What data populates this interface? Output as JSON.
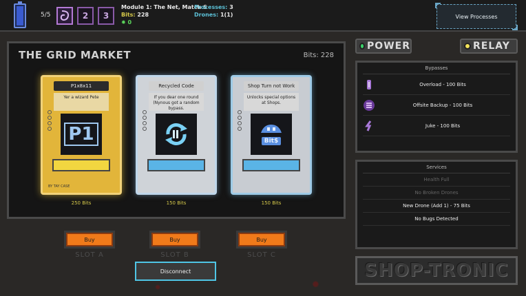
{
  "topbar": {
    "battery_count": "5/5",
    "slots": [
      "",
      "2",
      "3"
    ],
    "module_title": "Module 1: The Net, Match 6",
    "bits_label": "Bits:",
    "bits_value": "228",
    "bugs_value": "0",
    "processes_label": "Processes:",
    "processes_value": "3",
    "drones_label": "Drones:",
    "drones_value": "1(1)",
    "view_processes": "View Processes"
  },
  "market": {
    "title": "THE GRID MARKET",
    "bits": "Bits: 228",
    "cards": [
      {
        "title": "P1x8x11",
        "desc": "Yer a wizard Pete",
        "art_text": "P1",
        "footer": "BY TAY CASE",
        "price": "250 Bits"
      },
      {
        "title": "Recycled Code",
        "desc": "If you dear one round (Nynous got a random bypass.",
        "price": "150 Bits"
      },
      {
        "title": "Shop Turn not Work",
        "desc": "Unlocks special options at Shops.",
        "art_text": "Bit$",
        "price": "150 Bits"
      }
    ]
  },
  "buy": {
    "buttons": [
      "Buy",
      "Buy",
      "Buy"
    ],
    "slots": [
      "SLOT A",
      "SLOT B",
      "SLOT C"
    ],
    "disconnect": "Disconnect"
  },
  "toggles": {
    "power": "POWER",
    "relay": "RELAY"
  },
  "bypasses": {
    "title": "Bypasses",
    "items": [
      "Overload - 100 Bits",
      "Offsite Backup - 100 Bits",
      "Juke - 100 Bits"
    ]
  },
  "services": {
    "title": "Services",
    "items": [
      "Health Full",
      "No Broken Drones",
      "New Drone (Add 1) - 75 Bits",
      "No Bugs Detected"
    ]
  },
  "logo": "SHOP-TRONIC",
  "colors": {
    "accent_gold": "#e2b53a",
    "accent_cyan": "#4fc6e6",
    "buy_orange": "#f07a1a"
  }
}
